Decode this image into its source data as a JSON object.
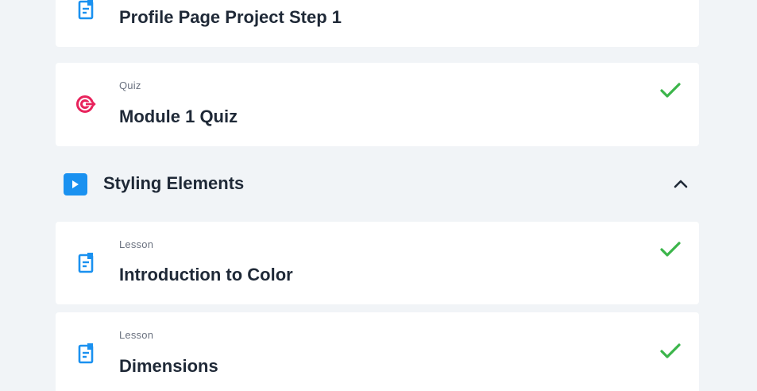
{
  "items": [
    {
      "type_label": "",
      "title": "Profile Page Project Step 1",
      "icon": "lesson-document-icon",
      "completed": false
    },
    {
      "type_label": "Quiz",
      "title": "Module 1 Quiz",
      "icon": "quiz-target-icon",
      "completed": true
    },
    {
      "type_label": "Lesson",
      "title": "Introduction to Color",
      "icon": "lesson-document-icon",
      "completed": true
    },
    {
      "type_label": "Lesson",
      "title": "Dimensions",
      "icon": "lesson-document-icon",
      "completed": true
    }
  ],
  "section": {
    "title": "Styling Elements",
    "expanded": true,
    "icon": "play-icon",
    "toggle_icon": "chevron-up-icon"
  },
  "colors": {
    "background": "#f1f4f7",
    "accent_blue": "#1a91f0",
    "quiz_pink": "#e8235c",
    "check_green": "#3bb54a"
  }
}
